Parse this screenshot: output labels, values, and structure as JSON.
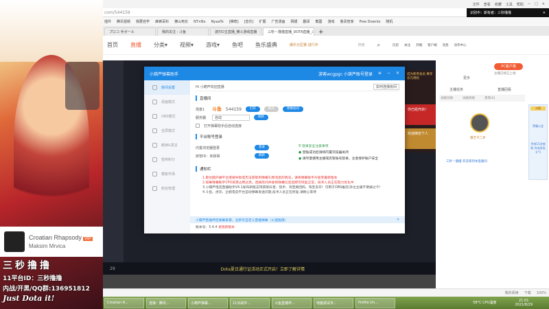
{
  "overlay": {
    "music_title": "Croatian Rhapsody",
    "music_vip": "VIP",
    "music_artist": "Maksim Mrvica",
    "stream_name": "三秒撸撸",
    "stream_id": "11平台ID：三秒撸撸",
    "stream_qq": "内战/开黑/QQ群:136951812",
    "slogan": "Just Dota it!"
  },
  "browser": {
    "menu": [
      "文件",
      "查看",
      "收藏",
      "工具",
      "帮助"
    ],
    "address": "com/544159",
    "toast": "识别中：斯有者：三秒撸撸",
    "bookmarks": [
      "插件",
      "腾讯视频",
      "我要自学",
      "蜂蜂百科",
      "佛山电长",
      "NT×Bo",
      "NyaaTo",
      "[推荐]",
      "[音乐]",
      "扩展",
      "广告漫画",
      "网银",
      "翻译",
      "截图",
      "游戏",
      "鲁贵管家",
      "Free Downlo",
      "随机"
    ],
    "tabs": [
      "プロコ 手ボール",
      "我的关注 - 斗鱼",
      "波尔D主直播_横斗游戏直播",
      "三秒丶撸撸直播_DOTA直播_斗鱼"
    ],
    "nav": [
      "首页",
      "直播",
      "分类▾",
      "视频▾",
      "游戏▾",
      "鱼吧",
      "鱼乐盛典"
    ],
    "nav_badge": "娱乐分区赛 进行中",
    "search_placeholder": "搜索",
    "nav_icons": [
      "历史",
      "关注",
      "开播",
      "客户端",
      "消息",
      "创作中心"
    ],
    "player_notice": "Dota夏日通行证活动正式开启！立即了解详情",
    "viewer_count": "29",
    "right": {
      "pc_button": "PC客户端",
      "pc_sub": "主播已经已上线",
      "more": "更多",
      "rank_tabs": [
        "贡献日榜",
        "贡献周榜",
        "贵宾(0)"
      ],
      "rank_title": "主播任务",
      "replay": "直播回看",
      "top_user": "猜艺卡二步",
      "chat": "三秒丶撸撸 欢迎来到本直播间",
      "promo1": "你已经开启！",
      "promo2": "欢迎绑定个人",
      "promo_top": "成为新贵会员 尊享非凡特权",
      "card_label": "刀塔",
      "card_sub": "荣耀公会",
      "card_task": "完成15次抽取 合成双倍卡*1"
    },
    "status": [
      "我的阅读",
      "下载",
      "100%"
    ]
  },
  "dialog": {
    "title": "小葫芦弹幕助手",
    "login": "游客wcgpgc  小葫芦账号登录",
    "controls": [
      "≡",
      "−",
      "×"
    ],
    "sidebar": [
      "房间设置",
      "桌面模式",
      "OBS模式",
      "全屏模式",
      "朗读&发言",
      "签到积分",
      "模板市场",
      "粉丝管理"
    ],
    "breadcrumb": "Hi  小葫芦欢迎直播",
    "connect_help": "如何连接房间",
    "sec_room": "直播间",
    "room_label": "场景1",
    "platform": "斗鱼",
    "room_id": "544159",
    "btn_open": "打开",
    "btn_off": "断开",
    "btn_change": "更换房间",
    "server_label": "服务器",
    "server_value": "自动",
    "btn_refresh": "刷新",
    "auto_connect": "打开弹幕助手后自动连接",
    "sec_account": "平台账号登录",
    "inner_login": "内置浏览器登录",
    "btn_login": "登录",
    "room_admin": "房管ID：未获得",
    "btn_refresh2": "刷新",
    "safe_title": "登录安全注意事项",
    "safe_tips": [
      "登陆成功后请将内置浏览器关闭",
      "请尽量使用主播或房管账号登录，注意保护账户安全"
    ],
    "sec_notice": "通知栏",
    "notices_red": [
      "1.斯达国外播平台连接失败或无法获取到弹幕礼物消息的情况，请将弹幕助手升级至最新版本",
      "2.如果弹幕助手CPU资源占用过高，连接房间并收到弹幕信息后即可恢复正常，技术人员正在努力优化中"
    ],
    "notices": [
      "3.小葫芦电竞直播助手V4.1发布新版支持获取抖音、快手、淘宝换回码、淘宝多开！可用于OBS推流/多位主播不要被过卡！",
      "4.斗鱼、虎牙、企鹅电竞平台自动弹幕发送问题,技术人员正在修复,请耐心等待"
    ],
    "tip": "小葫芦直播伴侣弹幕来袭，全新可自定义直播弹幕（火速围观）",
    "version_label": "版本号：5.4.4",
    "version_link": "发现新版本"
  },
  "taskbar": {
    "items": [
      "Croatian R...",
      "连接：腾讯...",
      "小葫芦弹幕...",
      "11对战平...",
      "斗鱼直播伴...",
      "电脑调试专...",
      "Profile Un..."
    ],
    "cpu": "58°C CPU温度",
    "time": "21:01",
    "date": "2021/8/29"
  }
}
